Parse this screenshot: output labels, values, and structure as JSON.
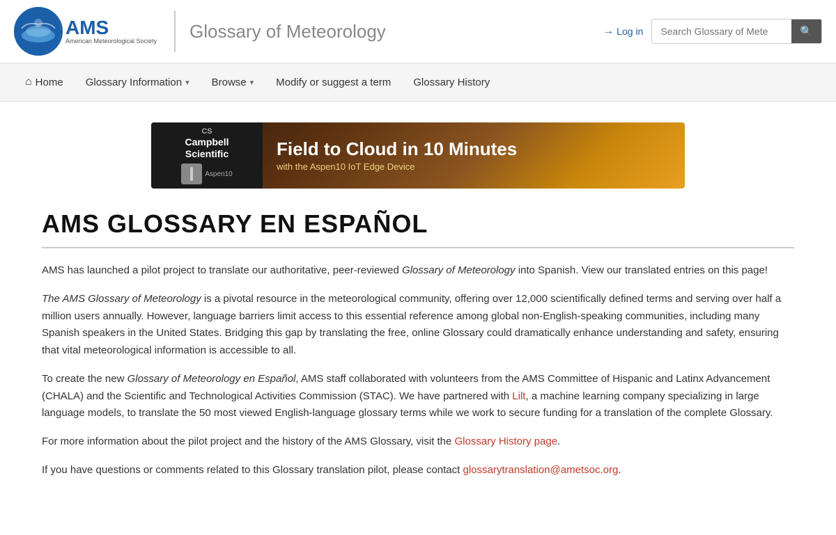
{
  "header": {
    "logo_ams": "AMS",
    "logo_society": "American Meteorological Society",
    "site_title": "Glossary of Meteorology",
    "search_placeholder": "Search Glossary of Mete",
    "login_label": "Log in"
  },
  "nav": {
    "home": "Home",
    "glossary_info": "Glossary Information",
    "browse": "Browse",
    "modify": "Modify or suggest a term",
    "history": "Glossary History"
  },
  "ad": {
    "brand_cs": "CS",
    "brand_name": "Campbell\nScientific",
    "headline": "Field to Cloud in 10 Minutes",
    "subtext": "with the Aspen10 IoT Edge Device"
  },
  "page": {
    "title": "AMS GLOSSARY EN ESPAÑOL",
    "para1_a": "AMS has launched a pilot project to translate our authoritative, peer-reviewed ",
    "para1_italic": "Glossary of Meteorology",
    "para1_b": " into Spanish. View our translated entries on this page!",
    "para2_a": "The AMS ",
    "para2_italic": "Glossary of Meteorology",
    "para2_b": " is a pivotal resource in the meteorological community, offering over 12,000 scientifically defined terms and serving over half a million users annually. However, language barriers limit access to this essential reference among global non-English-speaking communities, including many Spanish speakers in the United States. Bridging this gap by translating the free, online Glossary could dramatically enhance understanding and safety, ensuring that vital meteorological information is accessible to all.",
    "para3_a": "To create the new ",
    "para3_italic": "Glossary of Meteorology en Español",
    "para3_b": ", AMS staff collaborated with volunteers from the AMS Committee of Hispanic and Latinx Advancement (CHALA) and the Scientific and Technological Activities Commission (STAC). We have partnered with ",
    "para3_link_lilt": "Lilt",
    "para3_c": ", a machine learning company specializing in large language models, to translate the 50 most viewed English-language glossary terms while we work to secure funding for a translation of the complete Glossary.",
    "para4_a": "For more information about the pilot project and the history of the AMS Glossary, visit the ",
    "para4_link": "Glossary History page",
    "para4_b": ".",
    "para5_a": "If you have questions or comments related to this Glossary translation pilot, please contact ",
    "para5_email": "glossarytranslation@ametsoc.org",
    "para5_b": "."
  }
}
